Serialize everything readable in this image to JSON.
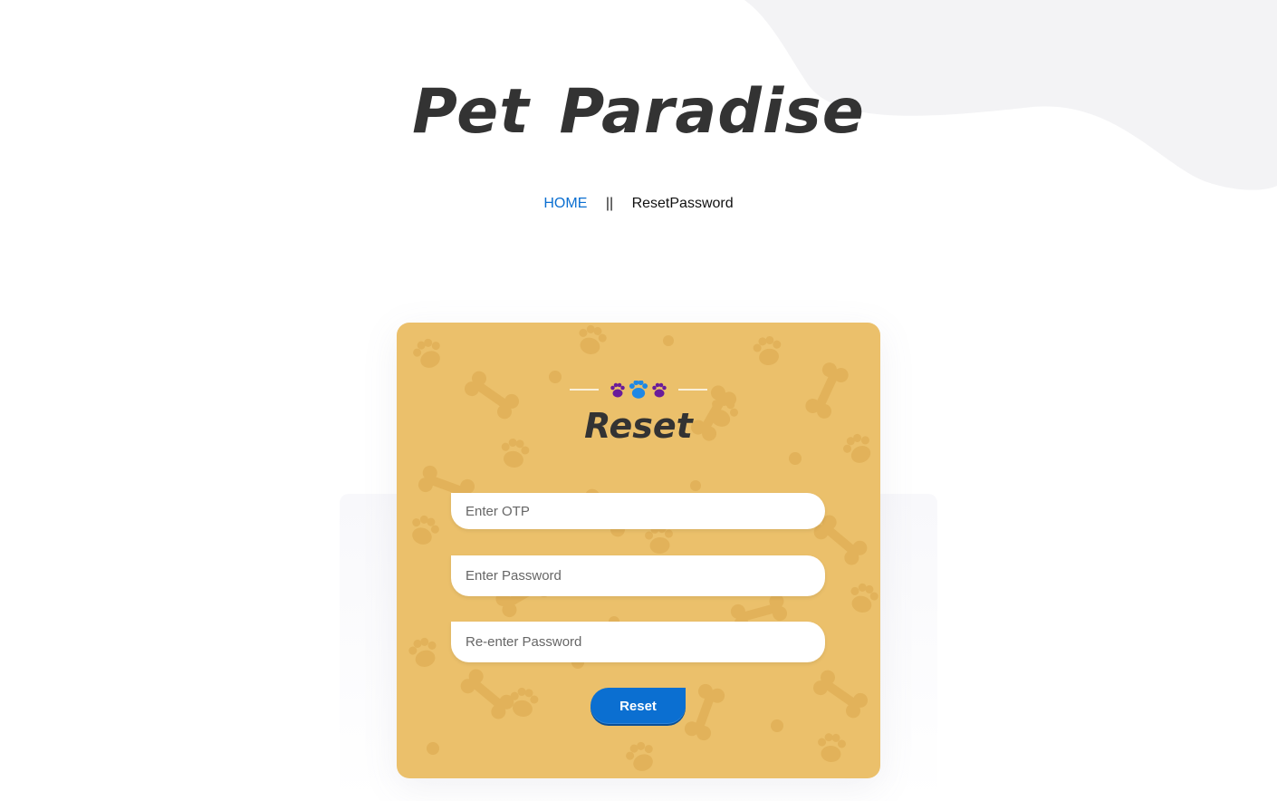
{
  "header": {
    "title": "Pet  Paradise"
  },
  "breadcrumb": {
    "home": "HOME",
    "separator": "||",
    "current": "ResetPassword"
  },
  "form": {
    "title": "Reset",
    "otp_placeholder": "Enter OTP",
    "password_placeholder": "Enter Password",
    "repassword_placeholder": "Re-enter Password",
    "submit_label": "Reset"
  },
  "icons": {
    "divider_paws": [
      "paw-icon",
      "paw-icon",
      "paw-icon"
    ],
    "card_background": "paw-and-bone-pattern"
  },
  "colors": {
    "card_background": "#ebc06b",
    "accent_blue": "#0b6fd1",
    "paw_purple": "#6a1b9a",
    "paw_blue": "#1e88e5",
    "title_text": "#333333",
    "blob": "#f3f3f5"
  }
}
